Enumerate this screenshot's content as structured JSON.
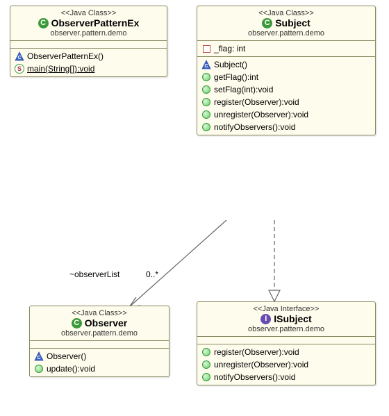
{
  "classes": {
    "observerPatternEx": {
      "stereotype": "<<Java Class>>",
      "name": "ObserverPatternEx",
      "package": "observer.pattern.demo",
      "ctor": "ObserverPatternEx()",
      "main": "main(String[]):void"
    },
    "subject": {
      "stereotype": "<<Java Class>>",
      "name": "Subject",
      "package": "observer.pattern.demo",
      "field": "_flag: int",
      "ctor": "Subject()",
      "ops": {
        "getFlag": "getFlag():int",
        "setFlag": "setFlag(int):void",
        "register": "register(Observer):void",
        "unregister": "unregister(Observer):void",
        "notify": "notifyObservers():void"
      }
    },
    "observer": {
      "stereotype": "<<Java Class>>",
      "name": "Observer",
      "package": "observer.pattern.demo",
      "ctor": "Observer()",
      "op_update": "update():void"
    },
    "isubject": {
      "stereotype": "<<Java Interface>>",
      "name": "ISubject",
      "package": "observer.pattern.demo",
      "ops": {
        "register": "register(Observer):void",
        "unregister": "unregister(Observer):void",
        "notify": "notifyObservers():void"
      }
    }
  },
  "assoc": {
    "observerList_name": "~observerList",
    "observerList_mult": "0..*"
  },
  "icons": {
    "C": "C",
    "I": "I",
    "S": "S"
  }
}
